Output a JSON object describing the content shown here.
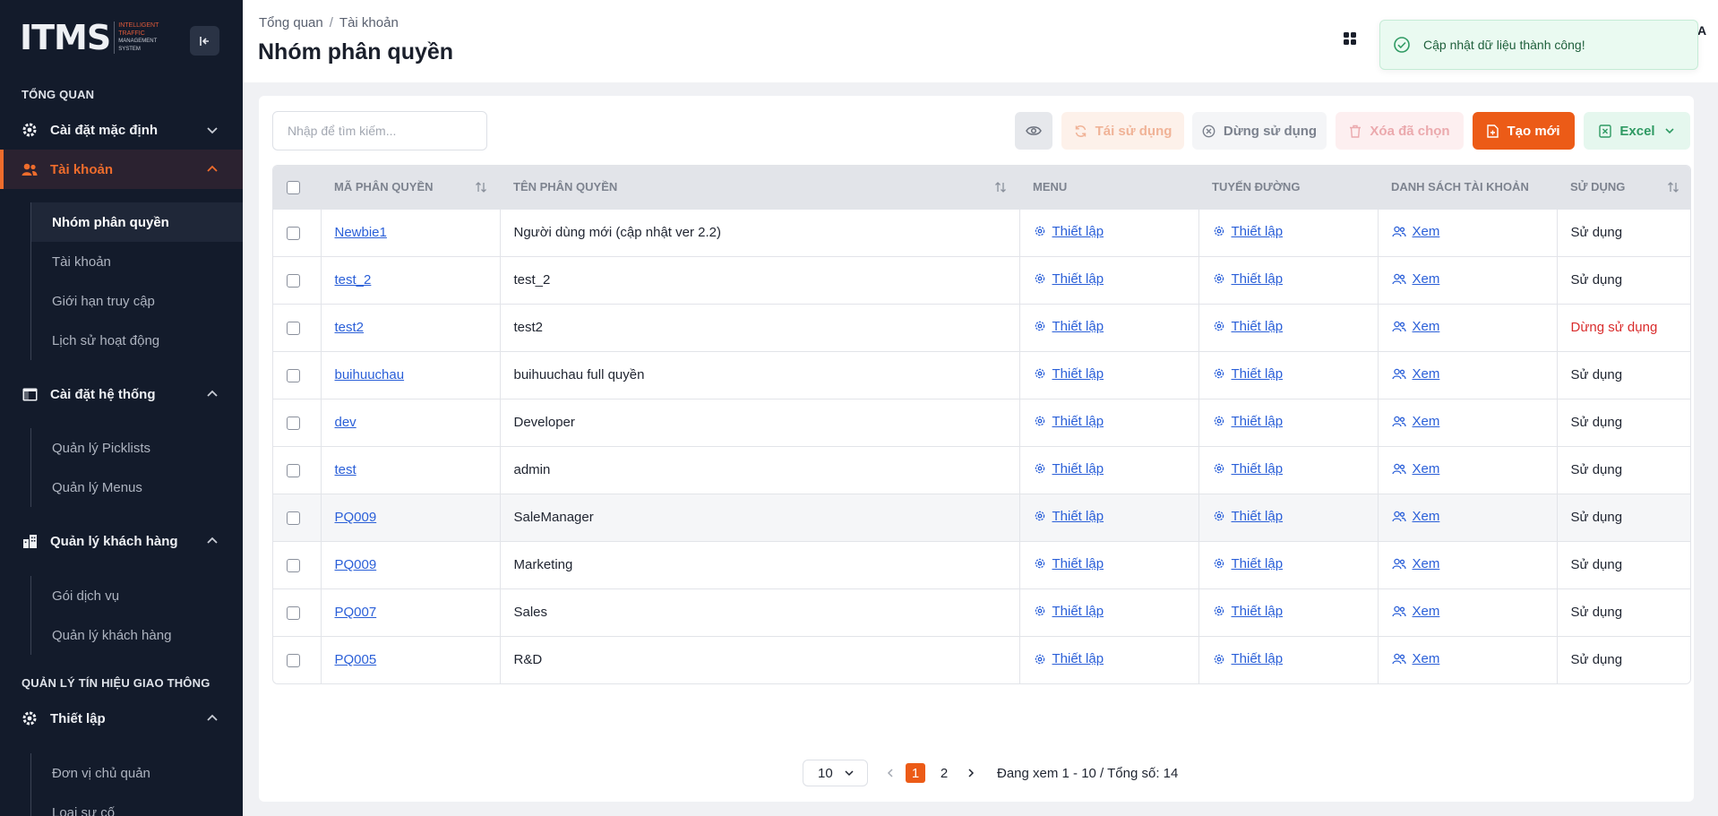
{
  "brand": {
    "mark": "ITMS",
    "sub_lines": [
      "INTELLIGENT",
      "TRAFFIC",
      "MANAGEMENT",
      "SYSTEM"
    ]
  },
  "sidebar": {
    "section1": "TỔNG QUAN",
    "groups": [
      {
        "label": "Cài đặt mặc định",
        "icon": "gear-icon"
      },
      {
        "label": "Tài khoản",
        "icon": "users-icon"
      },
      {
        "label": "Cài đặt hệ thống",
        "icon": "window-icon"
      },
      {
        "label": "Quản lý khách hàng",
        "icon": "building-icon"
      },
      {
        "label": "Thiết lập",
        "icon": "gear-icon"
      }
    ],
    "account_items": [
      "Nhóm phân quyền",
      "Tài khoản",
      "Giới hạn truy cập",
      "Lịch sử hoạt động"
    ],
    "system_items": [
      "Quản lý Picklists",
      "Quản lý Menus"
    ],
    "customer_items": [
      "Gói dịch vụ",
      "Quản lý khách hàng"
    ],
    "section2": "QUẢN LÝ TÍN HIỆU GIAO THÔNG",
    "setup_items": [
      "Đơn vị chủ quản",
      "Loại sự cố"
    ]
  },
  "header": {
    "breadcrumb": [
      "Tổng quan",
      "Tài khoản"
    ],
    "breadcrumb_sep": "/",
    "title": "Nhóm phân quyền",
    "user_initial": "A"
  },
  "toast": {
    "message": "Cập nhật dữ liệu thành công!",
    "color": "#1e5f3b"
  },
  "toolbar": {
    "search_placeholder": "Nhập để tìm kiếm...",
    "reuse": "Tái sử dụng",
    "stop": "Dừng sử dụng",
    "delete": "Xóa đã chọn",
    "create": "Tạo mới",
    "excel": "Excel"
  },
  "table": {
    "columns": [
      "MÃ PHÂN QUYỀN",
      "TÊN PHÂN QUYỀN",
      "MENU",
      "TUYẾN ĐƯỜNG",
      "DANH SÁCH TÀI KHOẢN",
      "SỬ DỤNG"
    ],
    "rows": [
      {
        "code": "Newbie1",
        "name": "Người dùng mới (cập nhật ver 2.2)",
        "menu": "Thiết lập",
        "route": "Thiết lập",
        "accounts": "Xem",
        "status": "Sử dụng"
      },
      {
        "code": "test_2",
        "name": "test_2",
        "menu": "Thiết lập",
        "route": "Thiết lập",
        "accounts": "Xem",
        "status": "Sử dụng"
      },
      {
        "code": "test2",
        "name": "test2",
        "menu": "Thiết lập",
        "route": "Thiết lập",
        "accounts": "Xem",
        "status": "Dừng sử dụng"
      },
      {
        "code": "buihuuchau",
        "name": "buihuuchau full quyền",
        "menu": "Thiết lập",
        "route": "Thiết lập",
        "accounts": "Xem",
        "status": "Sử dụng"
      },
      {
        "code": "dev",
        "name": "Developer",
        "menu": "Thiết lập",
        "route": "Thiết lập",
        "accounts": "Xem",
        "status": "Sử dụng"
      },
      {
        "code": "test",
        "name": "admin",
        "menu": "Thiết lập",
        "route": "Thiết lập",
        "accounts": "Xem",
        "status": "Sử dụng"
      },
      {
        "code": "PQ009",
        "name": "SaleManager",
        "menu": "Thiết lập",
        "route": "Thiết lập",
        "accounts": "Xem",
        "status": "Sử dụng"
      },
      {
        "code": "PQ009",
        "name": "Marketing",
        "menu": "Thiết lập",
        "route": "Thiết lập",
        "accounts": "Xem",
        "status": "Sử dụng"
      },
      {
        "code": "PQ007",
        "name": "Sales",
        "menu": "Thiết lập",
        "route": "Thiết lập",
        "accounts": "Xem",
        "status": "Sử dụng"
      },
      {
        "code": "PQ005",
        "name": "R&D",
        "menu": "Thiết lập",
        "route": "Thiết lập",
        "accounts": "Xem",
        "status": "Sử dụng"
      }
    ]
  },
  "pagination": {
    "page_size": "10",
    "pages": [
      "1",
      "2"
    ],
    "current_page": "1",
    "info": "Đang xem 1 - 10 / Tổng số: 14"
  },
  "colors": {
    "accent": "#ec5b17",
    "sidebar_bg": "#131b2b",
    "link": "#2a5fd8",
    "stopped": "#d92b2b",
    "success_bg": "#eafaf1"
  }
}
